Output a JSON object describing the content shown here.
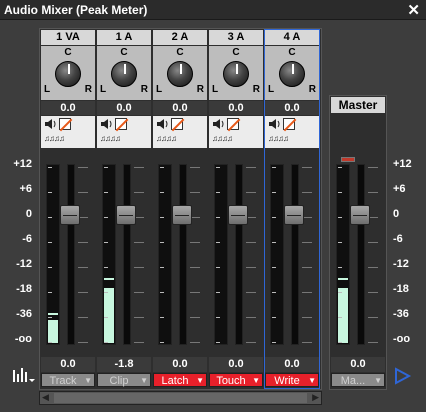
{
  "window": {
    "title": "Audio Mixer (Peak Meter)"
  },
  "scale_labels": [
    "+12",
    "+6",
    "0",
    "-6",
    "-12",
    "-18",
    "-36",
    "-oo"
  ],
  "channels": [
    {
      "name": "1 VA",
      "pan": "0.0",
      "vol": "0.0",
      "mode": "Track",
      "mode_style": "gray",
      "meter_level": 0.13,
      "peak_level": 0.16
    },
    {
      "name": "1 A",
      "pan": "0.0",
      "vol": "-1.8",
      "mode": "Clip",
      "mode_style": "gray",
      "meter_level": 0.31,
      "peak_level": 0.36
    },
    {
      "name": "2 A",
      "pan": "0.0",
      "vol": "0.0",
      "mode": "Latch",
      "mode_style": "red",
      "meter_level": 0.0,
      "peak_level": 0.0
    },
    {
      "name": "3 A",
      "pan": "0.0",
      "vol": "0.0",
      "mode": "Touch",
      "mode_style": "red",
      "meter_level": 0.0,
      "peak_level": 0.0
    },
    {
      "name": "4 A",
      "pan": "0.0",
      "vol": "0.0",
      "mode": "Write",
      "mode_style": "red",
      "meter_level": 0.0,
      "peak_level": 0.0
    }
  ],
  "master": {
    "name": "Master",
    "vol": "0.0",
    "mode": "Ma...",
    "meter_level": 0.31,
    "peak_level": 0.36
  },
  "knob_labels": {
    "center": "C",
    "left": "L",
    "right": "R"
  },
  "insert_icons": "♫♫♫♫",
  "colors": {
    "record": "#e8202a",
    "meter": "#c8f7df",
    "selected_outline": "#2f66d6"
  }
}
